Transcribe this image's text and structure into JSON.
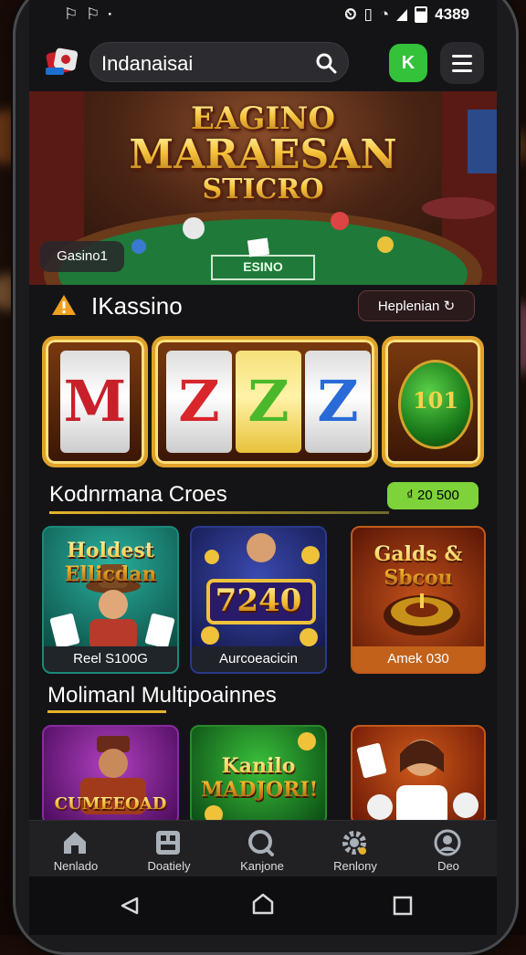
{
  "status": {
    "time": "4389",
    "left_icons": "⌀ ⌀"
  },
  "header": {
    "search_value": "Indanaisai",
    "quick_label": "K"
  },
  "hero": {
    "title_line1": "EAGINO",
    "title_line2": "MARAESAN",
    "title_line3": "STICRO",
    "table_text": "ESINO",
    "tag": "Gasino1"
  },
  "section1": {
    "title": "IKassino",
    "button": "Heplenian"
  },
  "slots": [
    {
      "symbols": [
        "M"
      ]
    },
    {
      "symbols": [
        "Z",
        "Z",
        "Z"
      ]
    },
    {
      "symbols": [
        "101"
      ]
    }
  ],
  "section2": {
    "title": "Kodnrmana Croes",
    "badge": "₫ 20 500"
  },
  "games": [
    {
      "title": "Holdest Ellicdan",
      "label": "Reel S100G"
    },
    {
      "title": "7240",
      "label": "Aurcoeacicin"
    },
    {
      "title": "Galds & Sbcou",
      "label": "Amek 030"
    }
  ],
  "section3": {
    "title": "Molimanl Multipoainnes"
  },
  "games2": [
    {
      "title": "CUMEEOAD"
    },
    {
      "title": "Kanilo MADJORI!"
    },
    {
      "title": ""
    }
  ],
  "nav": [
    {
      "label": "Nenlado",
      "icon": "home-icon"
    },
    {
      "label": "Doatiely",
      "icon": "dice-icon"
    },
    {
      "label": "Kanjone",
      "icon": "search-icon"
    },
    {
      "label": "Renlony",
      "icon": "gear-icon"
    },
    {
      "label": "Deo",
      "icon": "profile-icon"
    }
  ],
  "colors": {
    "accent_green": "#33c23a",
    "gold": "#e5b22a",
    "pill_green": "#7ed23a"
  }
}
